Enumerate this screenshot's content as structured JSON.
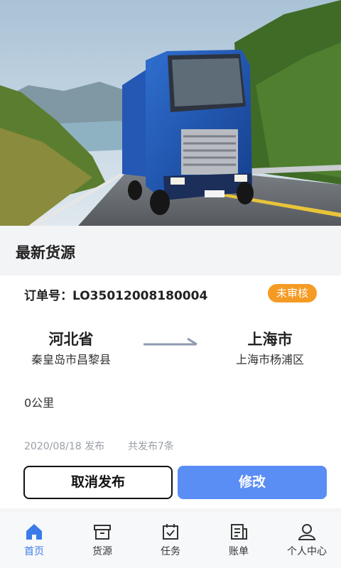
{
  "section": {
    "title": "最新货源"
  },
  "order": {
    "label": "订单号：",
    "number": "LO35012008180004",
    "status": "未审核",
    "from_province": "河北省",
    "from_city": "秦皇岛市昌黎县",
    "to_province": "上海市",
    "to_city": "上海市杨浦区",
    "distance": "0公里",
    "publish_date": "2020/08/18 发布",
    "publish_count": "共发布7条"
  },
  "buttons": {
    "cancel": "取消发布",
    "modify": "修改"
  },
  "nav": [
    {
      "label": "首页",
      "icon": "home-icon",
      "active": true
    },
    {
      "label": "货源",
      "icon": "box-icon",
      "active": false
    },
    {
      "label": "任务",
      "icon": "calendar-check-icon",
      "active": false
    },
    {
      "label": "账单",
      "icon": "bill-icon",
      "active": false
    },
    {
      "label": "个人中心",
      "icon": "user-icon",
      "active": false
    }
  ],
  "colors": {
    "accent": "#3b7be9",
    "badge": "#f59a23",
    "primary_button": "#5b8ef4"
  }
}
